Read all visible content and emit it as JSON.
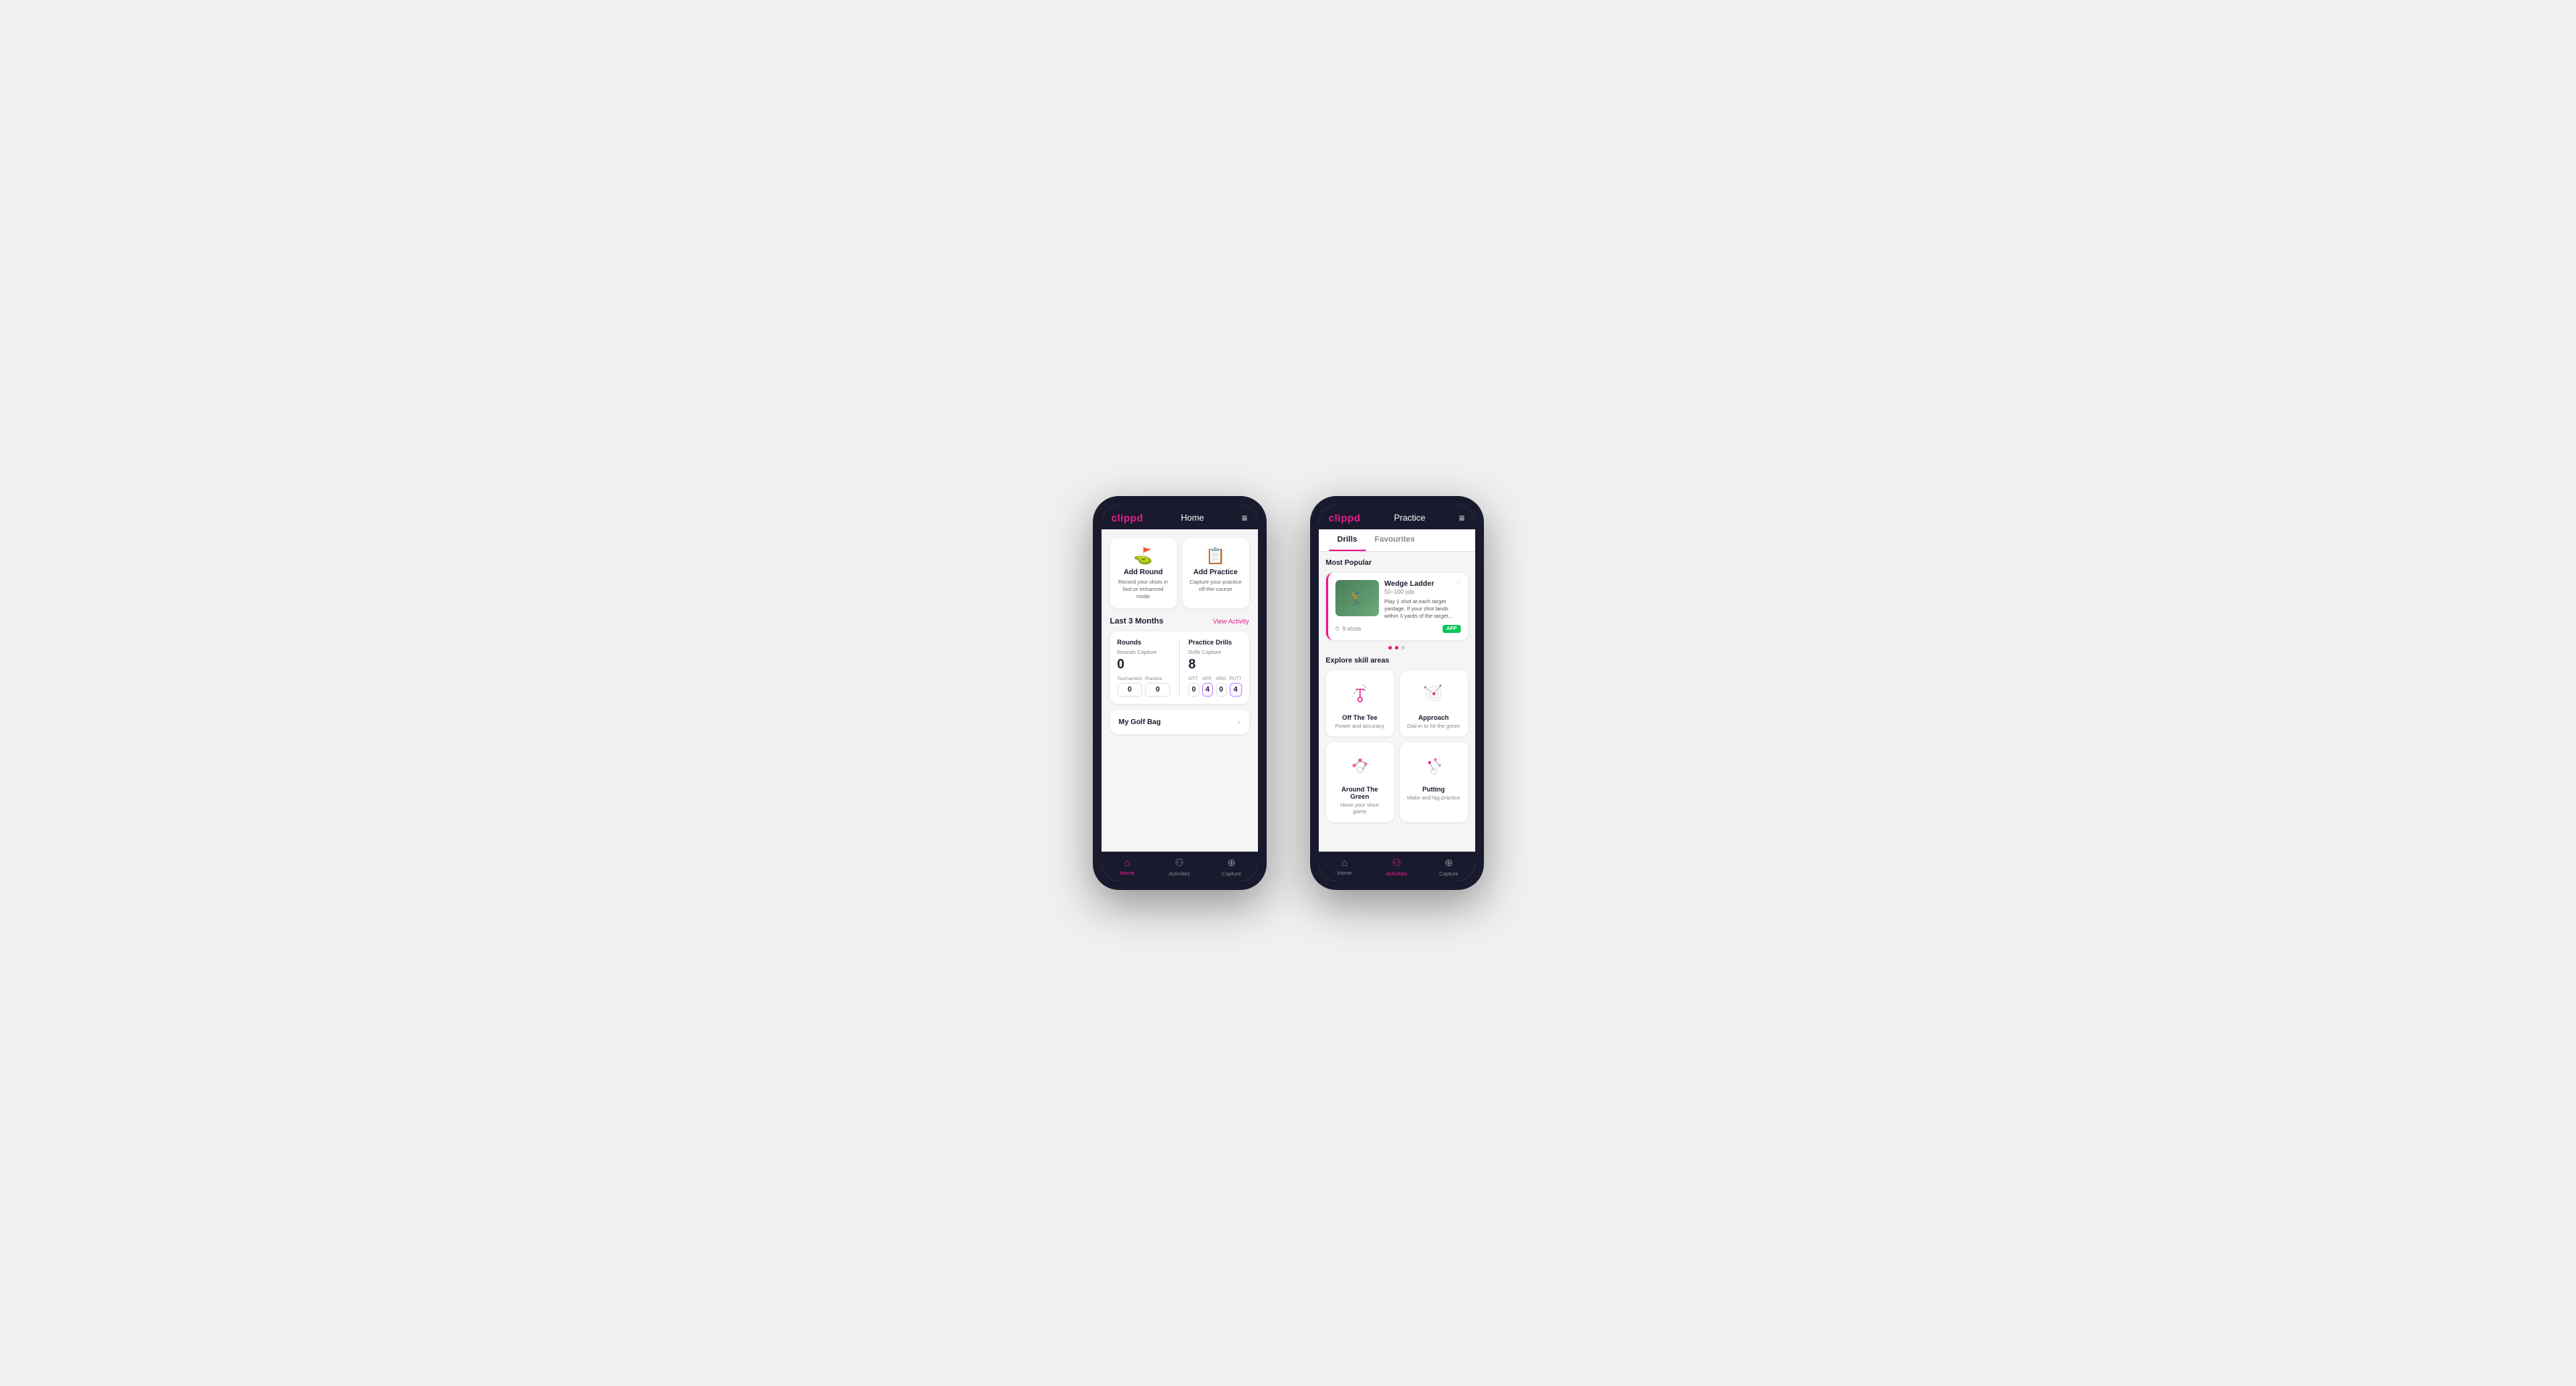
{
  "phone1": {
    "header": {
      "logo": "clippd",
      "title": "Home",
      "menu": "≡"
    },
    "addCards": [
      {
        "id": "add-round",
        "icon": "⛳",
        "title": "Add Round",
        "desc": "Record your shots in fast or enhanced mode"
      },
      {
        "id": "add-practice",
        "icon": "📋",
        "title": "Add Practice",
        "desc": "Capture your practice off-the-course"
      }
    ],
    "activity": {
      "sectionTitle": "Last 3 Months",
      "viewLink": "View Activity",
      "rounds": {
        "title": "Rounds",
        "captureLabel": "Rounds Capture",
        "captureValue": "0",
        "sub": [
          {
            "label": "Tournament",
            "value": "0"
          },
          {
            "label": "Practice",
            "value": "0"
          }
        ]
      },
      "drills": {
        "title": "Practice Drills",
        "captureLabel": "Drills Capture",
        "captureValue": "8",
        "sub": [
          {
            "label": "OTT",
            "value": "0"
          },
          {
            "label": "APP",
            "value": "4",
            "highlighted": true
          },
          {
            "label": "ARG",
            "value": "0"
          },
          {
            "label": "PUTT",
            "value": "4",
            "highlighted": true
          }
        ]
      }
    },
    "golfBag": {
      "label": "My Golf Bag"
    },
    "nav": [
      {
        "icon": "🏠",
        "label": "Home",
        "active": true
      },
      {
        "icon": "♟",
        "label": "Activities",
        "active": false
      },
      {
        "icon": "➕",
        "label": "Capture",
        "active": false
      }
    ]
  },
  "phone2": {
    "header": {
      "logo": "clippd",
      "title": "Practice",
      "menu": "≡"
    },
    "tabs": [
      {
        "label": "Drills",
        "active": true
      },
      {
        "label": "Favourites",
        "active": false
      }
    ],
    "mostPopular": {
      "label": "Most Popular",
      "card": {
        "title": "Wedge Ladder",
        "subtitle": "50–100 yds",
        "desc": "Play 1 shot at each target yardage. If your shot lands within 3 yards of the target...",
        "shots": "9 shots",
        "badge": "APP"
      },
      "dots": [
        false,
        true,
        false
      ]
    },
    "explore": {
      "label": "Explore skill areas",
      "skills": [
        {
          "id": "off-the-tee",
          "name": "Off The Tee",
          "desc": "Power and accuracy",
          "icon": "tee"
        },
        {
          "id": "approach",
          "name": "Approach",
          "desc": "Dial-in to hit the green",
          "icon": "approach"
        },
        {
          "id": "around-the-green",
          "name": "Around The Green",
          "desc": "Hone your short game",
          "icon": "atg"
        },
        {
          "id": "putting",
          "name": "Putting",
          "desc": "Make and lag practice",
          "icon": "putt"
        }
      ]
    },
    "nav": [
      {
        "icon": "🏠",
        "label": "Home",
        "active": false
      },
      {
        "icon": "♟",
        "label": "Activities",
        "active": true
      },
      {
        "icon": "➕",
        "label": "Capture",
        "active": false
      }
    ]
  }
}
